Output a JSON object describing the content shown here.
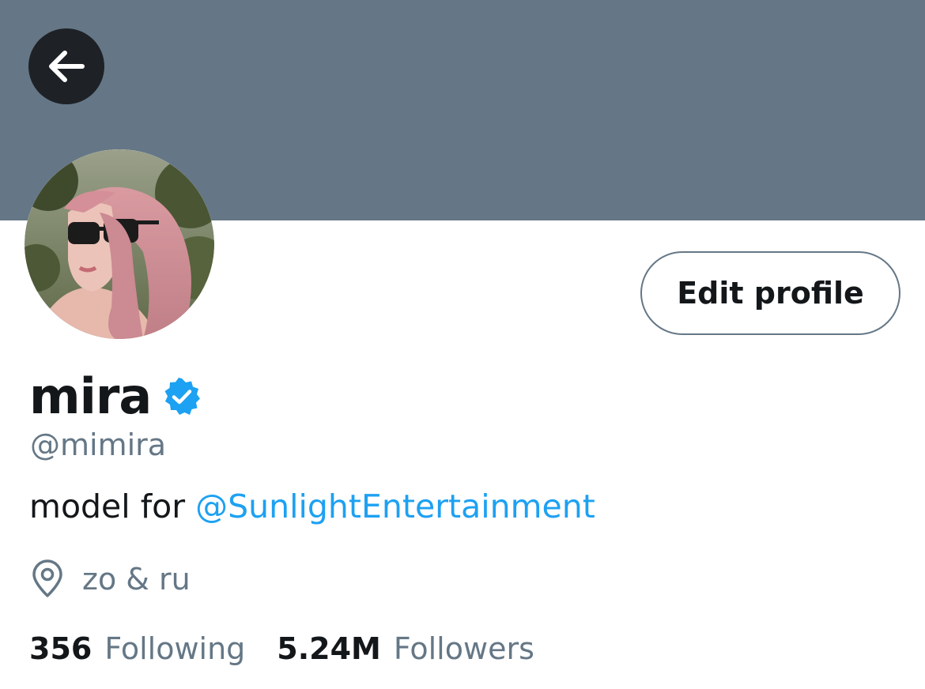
{
  "profile": {
    "display_name": "mira",
    "handle": "@mimira",
    "bio_text": "model for ",
    "bio_mention": "@SunlightEntertainment",
    "location": "zo & ru",
    "verified": true
  },
  "actions": {
    "edit_profile_label": "Edit profile"
  },
  "stats": {
    "following_count": "356",
    "following_label": "Following",
    "followers_count": "5.24M",
    "followers_label": "Followers"
  },
  "icons": {
    "back": "back-arrow-icon",
    "verified": "verified-badge-icon",
    "location": "location-pin-icon"
  },
  "colors": {
    "banner": "#657786",
    "accent": "#1da1f2",
    "secondary_text": "#657786",
    "primary_text": "#14171a",
    "back_button": "#1e2126"
  }
}
